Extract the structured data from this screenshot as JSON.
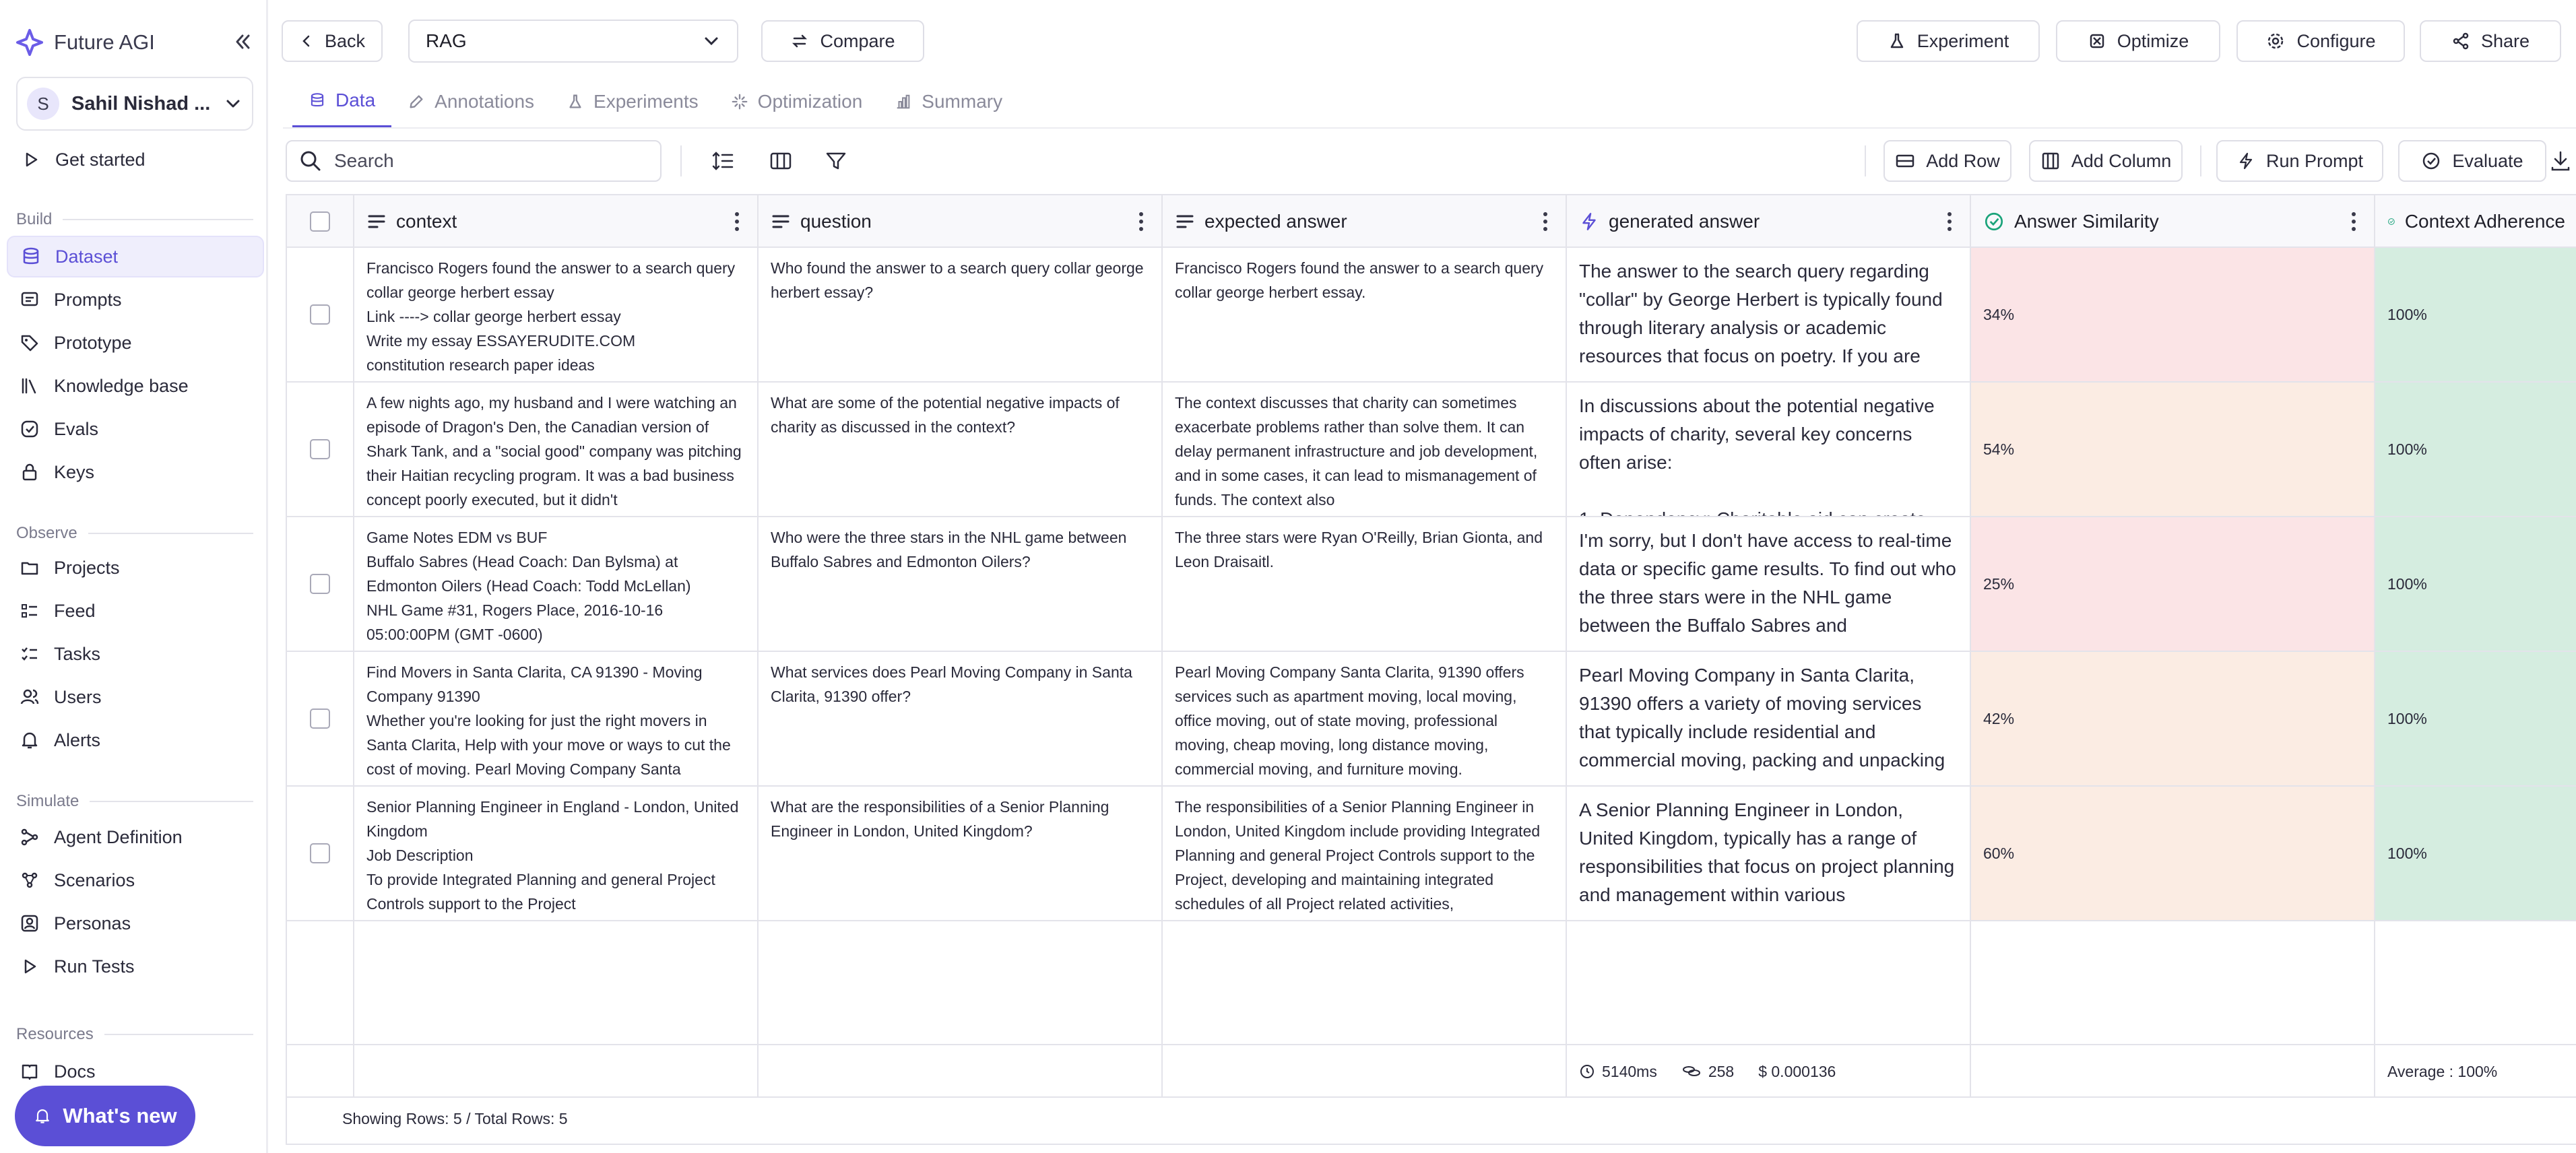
{
  "brand": {
    "name": "Future AGI"
  },
  "org": {
    "initial": "S",
    "name": "Sahil Nishad ..."
  },
  "sidebar": {
    "get_started": "Get started",
    "sections": [
      {
        "title": "Build",
        "items": [
          {
            "label": "Dataset",
            "icon": "database-icon",
            "active": true
          },
          {
            "label": "Prompts",
            "icon": "prompt-icon"
          },
          {
            "label": "Prototype",
            "icon": "tag-icon"
          },
          {
            "label": "Knowledge base",
            "icon": "books-icon"
          },
          {
            "label": "Evals",
            "icon": "check-circle-icon"
          },
          {
            "label": "Keys",
            "icon": "lock-icon"
          }
        ]
      },
      {
        "title": "Observe",
        "items": [
          {
            "label": "Projects",
            "icon": "folder-icon"
          },
          {
            "label": "Feed",
            "icon": "list-icon"
          },
          {
            "label": "Tasks",
            "icon": "tasks-icon"
          },
          {
            "label": "Users",
            "icon": "users-icon"
          },
          {
            "label": "Alerts",
            "icon": "bell-icon"
          }
        ]
      },
      {
        "title": "Simulate",
        "items": [
          {
            "label": "Agent Definition",
            "icon": "agent-icon"
          },
          {
            "label": "Scenarios",
            "icon": "scenarios-icon"
          },
          {
            "label": "Personas",
            "icon": "personas-icon"
          },
          {
            "label": "Run Tests",
            "icon": "play-icon"
          }
        ]
      },
      {
        "title": "Resources",
        "items": [
          {
            "label": "Docs",
            "icon": "docs-icon"
          }
        ]
      }
    ],
    "whats_new": "What's new"
  },
  "topbar": {
    "back": "Back",
    "dataset_select": "RAG",
    "compare": "Compare",
    "experiment": "Experiment",
    "optimize": "Optimize",
    "configure": "Configure",
    "share": "Share"
  },
  "tabs": [
    "Data",
    "Annotations",
    "Experiments",
    "Optimization",
    "Summary"
  ],
  "toolbar": {
    "search_placeholder": "Search",
    "add_row": "Add Row",
    "add_column": "Add Column",
    "run_prompt": "Run Prompt",
    "evaluate": "Evaluate"
  },
  "columns": [
    "context",
    "question",
    "expected answer",
    "generated answer",
    "Answer Similarity",
    "Context Adherence"
  ],
  "rows": [
    {
      "context": "Francisco Rogers found the answer to a search query collar george herbert essay\nLink ----> collar george herbert essay\nWrite my essay ESSAYERUDITE.COM\nconstitution research paper ideas",
      "question": "Who found the answer to a search query collar george herbert essay?",
      "expected": "Francisco Rogers found the answer to a search query collar george herbert essay.",
      "generated": "The answer to the search query regarding \"collar\" by George Herbert is typically found through literary analysis or academic resources that focus on poetry. If you are",
      "similarity": "34%",
      "adherence": "100%"
    },
    {
      "context": "A few nights ago, my husband and I were watching an episode of Dragon's Den, the Canadian version of Shark Tank, and a \"social good\" company was pitching their Haitian recycling program. It was a bad business concept poorly executed, but it didn't",
      "question": "What are some of the potential negative impacts of charity as discussed in the context?",
      "expected": "The context discusses that charity can sometimes exacerbate problems rather than solve them. It can delay permanent infrastructure and job development, and in some cases, it can lead to mismanagement of funds. The context also",
      "generated": "In discussions about the potential negative impacts of charity, several key concerns often arise:\n\n1. Dependency: Charitable aid can create",
      "similarity": "54%",
      "adherence": "100%"
    },
    {
      "context": "Game Notes EDM vs BUF\nBuffalo Sabres (Head Coach: Dan Bylsma) at Edmonton Oilers (Head Coach: Todd McLellan)\nNHL Game #31, Rogers Place, 2016-10-16\n05:00:00PM (GMT -0600)",
      "question": "Who were the three stars in the NHL game between Buffalo Sabres and Edmonton Oilers?",
      "expected": "The three stars were Ryan O'Reilly, Brian Gionta, and Leon Draisaitl.",
      "generated": "I'm sorry, but I don't have access to real-time data or specific game results. To find out who the three stars were in the NHL game between the Buffalo Sabres and",
      "similarity": "25%",
      "adherence": "100%"
    },
    {
      "context": "Find Movers in Santa Clarita, CA 91390 - Moving Company 91390\nWhether you're looking for just the right movers in Santa Clarita, Help with your move or ways to cut the cost of moving. Pearl Moving Company Santa",
      "question": "What services does Pearl Moving Company in Santa Clarita, 91390 offer?",
      "expected": "Pearl Moving Company Santa Clarita, 91390 offers services such as apartment moving, local moving, office moving, out of state moving, professional moving, cheap moving, long distance moving, commercial moving, and furniture moving.",
      "generated": "Pearl Moving Company in Santa Clarita, 91390 offers a variety of moving services that typically include residential and commercial moving, packing and unpacking",
      "similarity": "42%",
      "adherence": "100%"
    },
    {
      "context": "Senior Planning Engineer in England - London, United Kingdom\nJob Description\nTo provide Integrated Planning and general Project Controls support to the Project",
      "question": "What are the responsibilities of a Senior Planning Engineer in London, United Kingdom?",
      "expected": "The responsibilities of a Senior Planning Engineer in London, United Kingdom include providing Integrated Planning and general Project Controls support to the Project, developing and maintaining integrated schedules of all Project related activities,",
      "generated": "A Senior Planning Engineer in London, United Kingdom, typically has a range of responsibilities that focus on project planning and management within various",
      "similarity": "60%",
      "adherence": "100%"
    }
  ],
  "footer": {
    "latency": "5140ms",
    "tokens": "258",
    "cost": "$ 0.000136",
    "average": "Average : 100%"
  },
  "status": {
    "showing": "Showing Rows: 5 / Total Rows: 5"
  },
  "colors": {
    "accent": "#5b4fd6",
    "low_score": "#fbe4e6",
    "mid_score": "#fbece3",
    "high_score": "#d5ede0"
  }
}
